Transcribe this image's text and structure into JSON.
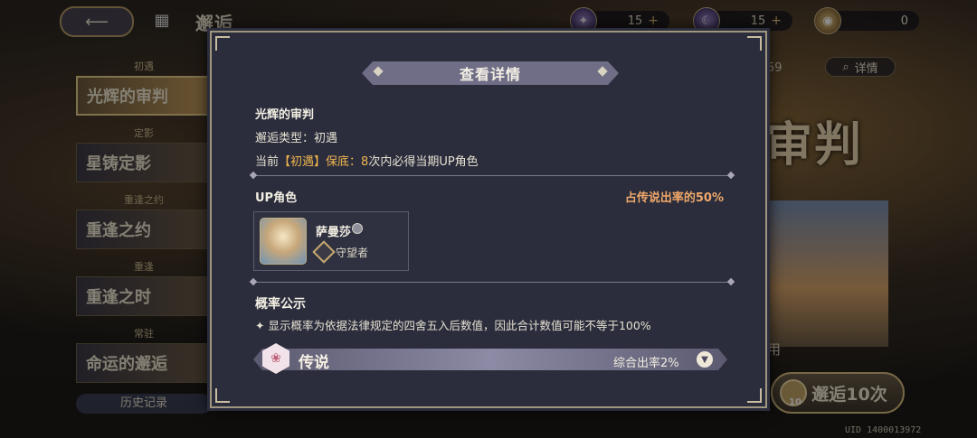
{
  "header": {
    "back_icon": "back-arrow-icon",
    "title": "邂逅",
    "currencies": [
      {
        "icon": "star-crystal-icon",
        "amount": "15",
        "plus": "+"
      },
      {
        "icon": "moon-orb-icon",
        "amount": "15",
        "plus": "+"
      },
      {
        "icon": "coin-icon",
        "amount": "0"
      }
    ]
  },
  "sidebar": {
    "items": [
      {
        "tag": "初遇",
        "label": "光辉的审判"
      },
      {
        "tag": "定影",
        "label": "星铸定影"
      },
      {
        "tag": "重逢之约",
        "label": "重逢之约"
      },
      {
        "tag": "重逢",
        "label": "重逢之时"
      },
      {
        "tag": "常驻",
        "label": "命运的邂逅"
      }
    ],
    "history_label": "历史记录"
  },
  "background": {
    "timer": "59",
    "detail_label": "详情",
    "banner_text": "审判",
    "use_label": "用",
    "summon_label": "邂逅10次",
    "summon_cost": "10",
    "uid": "UID 1400013972"
  },
  "modal": {
    "title": "查看详情",
    "banner_name": "光辉的审判",
    "type_line": "邂逅类型：初遇",
    "pity": {
      "prefix": "当前",
      "tag": "【初遇】保底：",
      "count": "8",
      "suffix": "次内必得当期UP角色"
    },
    "up_section": {
      "title": "UP角色",
      "rate_text": "占传说出率的50%"
    },
    "character": {
      "name": "萨曼莎",
      "role": "守望者"
    },
    "prob_section": {
      "title": "概率公示",
      "note": "✦ 显示概率为依据法律规定的四舍五入后数值，因此合计数值可能不等于100%"
    },
    "rarity": {
      "label": "传说",
      "rate": "综合出率2%"
    }
  }
}
